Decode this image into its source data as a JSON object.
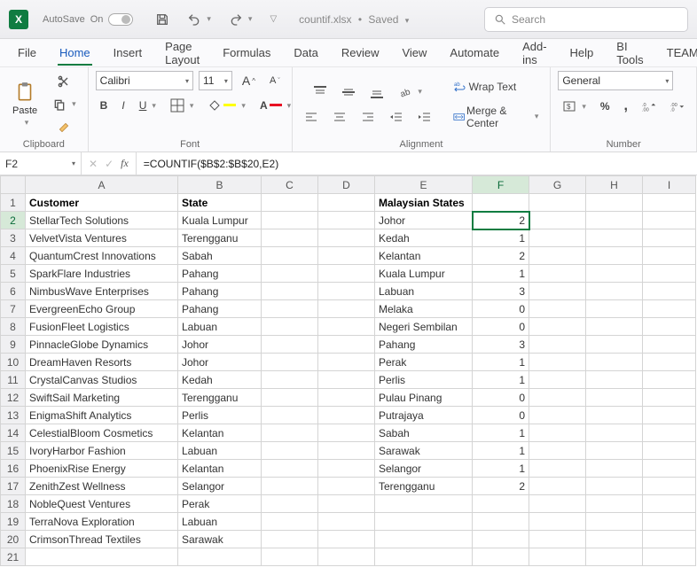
{
  "titlebar": {
    "app_abbrev": "X",
    "autosave_label": "AutoSave",
    "autosave_state": "On",
    "doc_name": "countif.xlsx",
    "doc_status": "Saved",
    "search_placeholder": "Search"
  },
  "menu": {
    "items": [
      "File",
      "Home",
      "Insert",
      "Page Layout",
      "Formulas",
      "Data",
      "Review",
      "View",
      "Automate",
      "Add-ins",
      "Help",
      "BI Tools",
      "TEAM"
    ],
    "active": "Home"
  },
  "ribbon": {
    "clipboard": {
      "paste": "Paste",
      "label": "Clipboard"
    },
    "font": {
      "name": "Calibri",
      "size": "11",
      "label": "Font",
      "bold": "B",
      "italic": "I",
      "underline": "U",
      "incA": "A",
      "decA": "A"
    },
    "alignment": {
      "wrap_label": "Wrap Text",
      "merge_label": "Merge & Center",
      "label": "Alignment"
    },
    "number": {
      "format": "General",
      "label": "Number",
      "comma": ","
    }
  },
  "fxbar": {
    "cell_ref": "F2",
    "fx_label": "fx",
    "formula": "=COUNTIF($B$2:$B$20,E2)"
  },
  "columns": [
    "A",
    "B",
    "C",
    "D",
    "E",
    "F",
    "G",
    "H",
    "I"
  ],
  "headers": {
    "A": "Customer",
    "B": "State",
    "E": "Malaysian States"
  },
  "rows": [
    {
      "A": "StellarTech Solutions",
      "B": "Kuala Lumpur",
      "E": "Johor",
      "F": 2
    },
    {
      "A": "VelvetVista Ventures",
      "B": "Terengganu",
      "E": "Kedah",
      "F": 1
    },
    {
      "A": "QuantumCrest Innovations",
      "B": "Sabah",
      "E": "Kelantan",
      "F": 2
    },
    {
      "A": "SparkFlare Industries",
      "B": "Pahang",
      "E": "Kuala Lumpur",
      "F": 1
    },
    {
      "A": "NimbusWave Enterprises",
      "B": "Pahang",
      "E": "Labuan",
      "F": 3
    },
    {
      "A": "EvergreenEcho Group",
      "B": "Pahang",
      "E": "Melaka",
      "F": 0
    },
    {
      "A": "FusionFleet Logistics",
      "B": "Labuan",
      "E": "Negeri Sembilan",
      "F": 0
    },
    {
      "A": "PinnacleGlobe Dynamics",
      "B": "Johor",
      "E": "Pahang",
      "F": 3
    },
    {
      "A": "DreamHaven Resorts",
      "B": "Johor",
      "E": "Perak",
      "F": 1
    },
    {
      "A": "CrystalCanvas Studios",
      "B": "Kedah",
      "E": "Perlis",
      "F": 1
    },
    {
      "A": "SwiftSail Marketing",
      "B": "Terengganu",
      "E": "Pulau Pinang",
      "F": 0
    },
    {
      "A": "EnigmaShift Analytics",
      "B": "Perlis",
      "E": "Putrajaya",
      "F": 0
    },
    {
      "A": "CelestialBloom Cosmetics",
      "B": "Kelantan",
      "E": "Sabah",
      "F": 1
    },
    {
      "A": "IvoryHarbor Fashion",
      "B": "Labuan",
      "E": "Sarawak",
      "F": 1
    },
    {
      "A": "PhoenixRise Energy",
      "B": "Kelantan",
      "E": "Selangor",
      "F": 1
    },
    {
      "A": "ZenithZest Wellness",
      "B": "Selangor",
      "E": "Terengganu",
      "F": 2
    },
    {
      "A": "NobleQuest Ventures",
      "B": "Perak"
    },
    {
      "A": "TerraNova Exploration",
      "B": "Labuan"
    },
    {
      "A": "CrimsonThread Textiles",
      "B": "Sarawak"
    },
    {}
  ],
  "selected_cell": "F2",
  "chart_data": {
    "type": "table",
    "title": "COUNTIF of States",
    "categories": [
      "Johor",
      "Kedah",
      "Kelantan",
      "Kuala Lumpur",
      "Labuan",
      "Melaka",
      "Negeri Sembilan",
      "Pahang",
      "Perak",
      "Perlis",
      "Pulau Pinang",
      "Putrajaya",
      "Sabah",
      "Sarawak",
      "Selangor",
      "Terengganu"
    ],
    "values": [
      2,
      1,
      2,
      1,
      3,
      0,
      0,
      3,
      1,
      1,
      0,
      0,
      1,
      1,
      1,
      2
    ]
  }
}
